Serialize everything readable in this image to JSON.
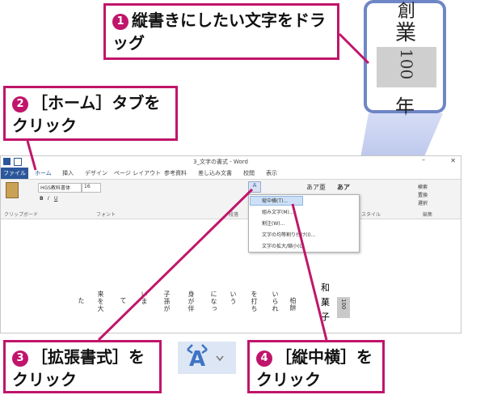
{
  "callouts": {
    "c1": {
      "num": "1",
      "text": "縦書きにしたい文字をドラッグ"
    },
    "c2": {
      "num": "2",
      "text": "［ホーム］タブをクリック"
    },
    "c3": {
      "num": "3",
      "text": "［拡張書式］をクリック"
    },
    "c4": {
      "num": "4",
      "text": "［縦中横］をクリック"
    }
  },
  "zoom": {
    "top": "創",
    "mid": "業",
    "selected": "100",
    "bottom": "年"
  },
  "word": {
    "title": "3_文字の書式 - Word",
    "tabs": [
      "ファイル",
      "ホーム",
      "挿入",
      "デザイン",
      "ページ レイアウト",
      "参考資料",
      "差し込み文書",
      "校閲",
      "表示"
    ],
    "font_name": "HGS教科書体",
    "font_size": "16",
    "groups": [
      "クリップボード",
      "フォント",
      "段落",
      "スタイル",
      "編集"
    ],
    "edit_items": [
      "検索",
      "置換",
      "選択"
    ],
    "style1": "あア亜",
    "style2": "あア",
    "body_text": [
      "和",
      "菓",
      "子"
    ],
    "selected_text": "100",
    "columns": [
      "た",
      "来を大",
      "て",
      "いま",
      "子孫が",
      "身が伴",
      "になっ",
      "いう",
      "を打ち",
      "いられ",
      "柏餅"
    ]
  },
  "menu": {
    "items": [
      "縦中横(T)...",
      "組み文字(M)...",
      "割注(W)...",
      "文字の均等割り付け(I)...",
      "文字の拡大/縮小(C)"
    ]
  },
  "icon_label": "拡張書式"
}
